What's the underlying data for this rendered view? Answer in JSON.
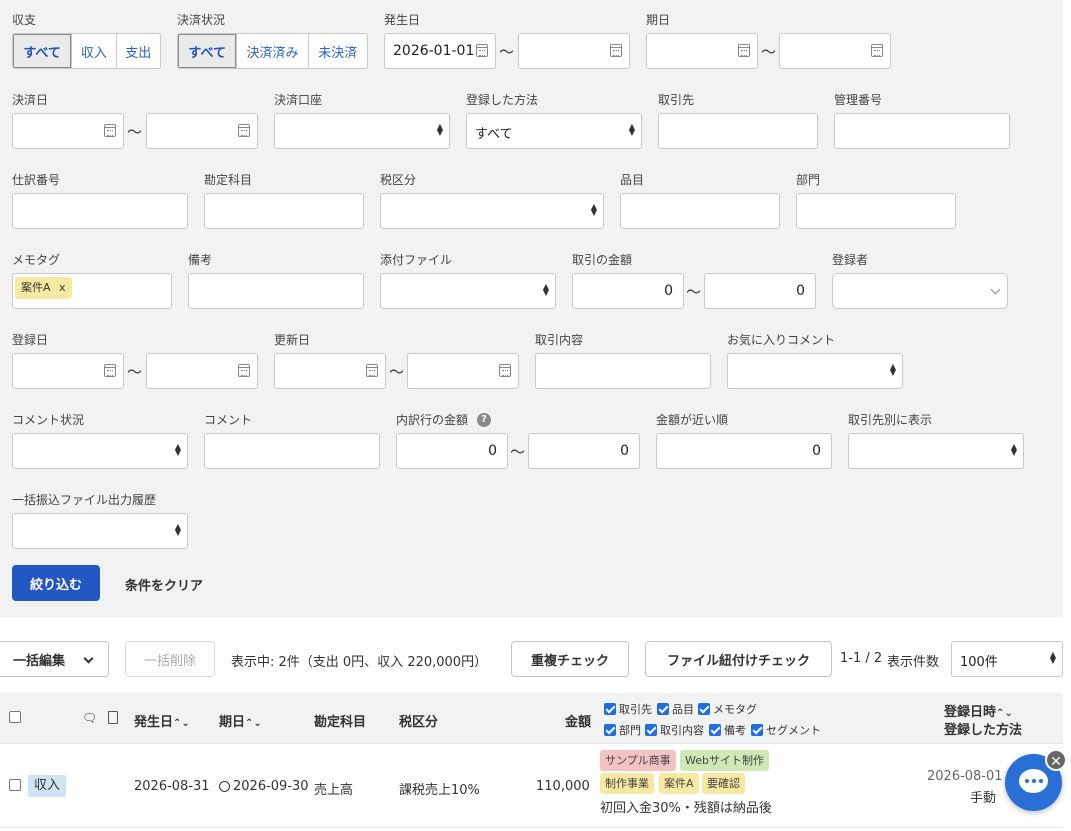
{
  "filters": {
    "shushi": {
      "label": "収支",
      "options": [
        "すべて",
        "収入",
        "支出"
      ]
    },
    "kessai_status": {
      "label": "決済状況",
      "options": [
        "すべて",
        "決済済み",
        "未決済"
      ]
    },
    "hassei_bi": {
      "label": "発生日",
      "from": "2026-01-01",
      "to": ""
    },
    "kijitsu": {
      "label": "期日"
    },
    "kessai_bi": {
      "label": "決済日"
    },
    "kessai_koza": {
      "label": "決済口座",
      "value": ""
    },
    "toroku_hoho": {
      "label": "登録した方法",
      "value": "すべて"
    },
    "torihikisaki": {
      "label": "取引先"
    },
    "kanri_bango": {
      "label": "管理番号"
    },
    "shiwake_bango": {
      "label": "仕訳番号"
    },
    "kanjo_kamoku": {
      "label": "勘定科目"
    },
    "zei_kubun": {
      "label": "税区分"
    },
    "hinmoku": {
      "label": "品目"
    },
    "bumon": {
      "label": "部門"
    },
    "memo_tag": {
      "label": "メモタグ",
      "tag": "案件A",
      "remove": "x"
    },
    "biko": {
      "label": "備考"
    },
    "tenpu_file": {
      "label": "添付ファイル"
    },
    "torihiki_kingaku": {
      "label": "取引の金額",
      "from": "0",
      "to": "0"
    },
    "torokusha": {
      "label": "登録者"
    },
    "toroku_bi": {
      "label": "登録日"
    },
    "koshin_bi": {
      "label": "更新日"
    },
    "torihiki_naiyo": {
      "label": "取引内容"
    },
    "okiniiri_comment": {
      "label": "お気に入りコメント"
    },
    "comment_status": {
      "label": "コメント状況"
    },
    "comment": {
      "label": "コメント"
    },
    "uchiwake_kingaku": {
      "label": "内訳行の金額",
      "from": "0",
      "to": "0"
    },
    "kingaku_chikai": {
      "label": "金額が近い順",
      "value": "0"
    },
    "torihikisaki_betsu": {
      "label": "取引先別に表示"
    },
    "ikkatsu_furikomi": {
      "label": "一括振込ファイル出力履歴"
    },
    "tilde": "〜",
    "submit_label": "絞り込む",
    "clear_label": "条件をクリア"
  },
  "toolbar": {
    "bulk_edit": "一括編集",
    "bulk_delete": "一括削除",
    "summary": "表示中: 2件（支出 0円、収入 220,000円）",
    "dup_check": "重複チェック",
    "file_check": "ファイル紐付けチェック",
    "paging": "1-1 / 2",
    "per_page_label": "表示件数",
    "per_page_value": "100件"
  },
  "table": {
    "headers": {
      "hassei_bi": "発生日",
      "kijitsu": "期日",
      "kanjo_kamoku": "勘定科目",
      "zei_kubun": "税区分",
      "kingaku": "金額",
      "toroku_nichiji": "登録日時",
      "toroku_hoho": "登録した方法"
    },
    "column_toggles": [
      "取引先",
      "品目",
      "メモタグ",
      "部門",
      "取引内容",
      "備考",
      "セグメント"
    ],
    "rows": [
      {
        "type": "収入",
        "hassei_bi": "2026-08-31",
        "kijitsu": "2026-09-30",
        "kanjo_kamoku": "売上高",
        "zei_kubun": "課税売上10%",
        "kingaku": "110,000",
        "chips": [
          {
            "text": "サンプル商事",
            "color": "#f3c2c2"
          },
          {
            "text": "Webサイト制作",
            "color": "#cfe8b5"
          },
          {
            "text": "制作事業",
            "color": "#f8e9a2"
          },
          {
            "text": "案件A",
            "color": "#f8e9a2"
          },
          {
            "text": "要確認",
            "color": "#f8e9a2"
          }
        ],
        "memo": "初回入金30%・残額は納品後",
        "toroku_bi": "2026-08-01",
        "toroku_hoho": "手動"
      }
    ]
  },
  "chat": {
    "close": "✕"
  }
}
